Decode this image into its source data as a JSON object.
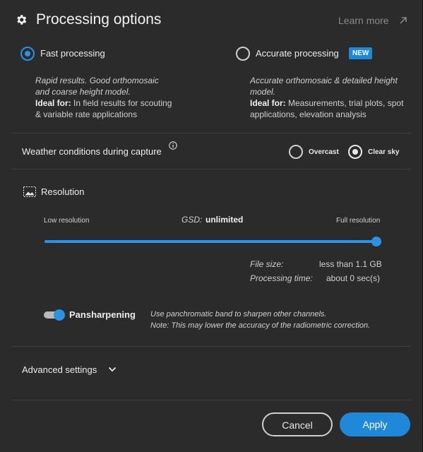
{
  "header": {
    "title": "Processing options",
    "learn_more": "Learn more",
    "gear_icon": "gear-icon",
    "external_icon": "external-link-icon"
  },
  "modes": {
    "fast": {
      "label": "Fast processing",
      "selected": true,
      "desc_line1": "Rapid results. Good orthomosaic",
      "desc_line2": "and coarse height model.",
      "ideal_for_label": "Ideal for:",
      "ideal_for_text1": " In field results for scouting",
      "ideal_for_text2": "& variable rate applications"
    },
    "accurate": {
      "label": "Accurate processing",
      "badge": "NEW",
      "selected": false,
      "desc_line1": "Accurate orthomosaic & detailed height",
      "desc_line2": "model.",
      "ideal_for_label": "Ideal for:",
      "ideal_for_text1": " Measurements, trial plots, spot",
      "ideal_for_text2": "applications, elevation analysis"
    }
  },
  "weather": {
    "label": "Weather conditions during capture",
    "info_icon": "info-icon",
    "options": [
      {
        "label": "Overcast",
        "selected": false
      },
      {
        "label": "Clear sky",
        "selected": true
      }
    ]
  },
  "resolution": {
    "label": "Resolution",
    "icon": "resolution-icon",
    "low_label": "Low resolution",
    "high_label": "Full resolution",
    "gsd_label": "GSD:",
    "gsd_value": "unlimited",
    "slider_value": 1.0,
    "file_size_label": "File size:",
    "file_size_value": "less than 1.1 GB",
    "processing_time_label": "Processing time:",
    "processing_time_value": "about 0 sec(s)"
  },
  "pansharpening": {
    "label": "Pansharpening",
    "enabled": true,
    "desc_line1": "Use panchromatic band to sharpen other channels.",
    "desc_line2": "Note: This may lower the accuracy of the radiometric correction."
  },
  "advanced": {
    "label": "Advanced settings",
    "icon": "chevron-down-icon"
  },
  "buttons": {
    "cancel": "Cancel",
    "apply": "Apply"
  },
  "colors": {
    "accent": "#2b93e6",
    "background": "#2b2b2b"
  }
}
